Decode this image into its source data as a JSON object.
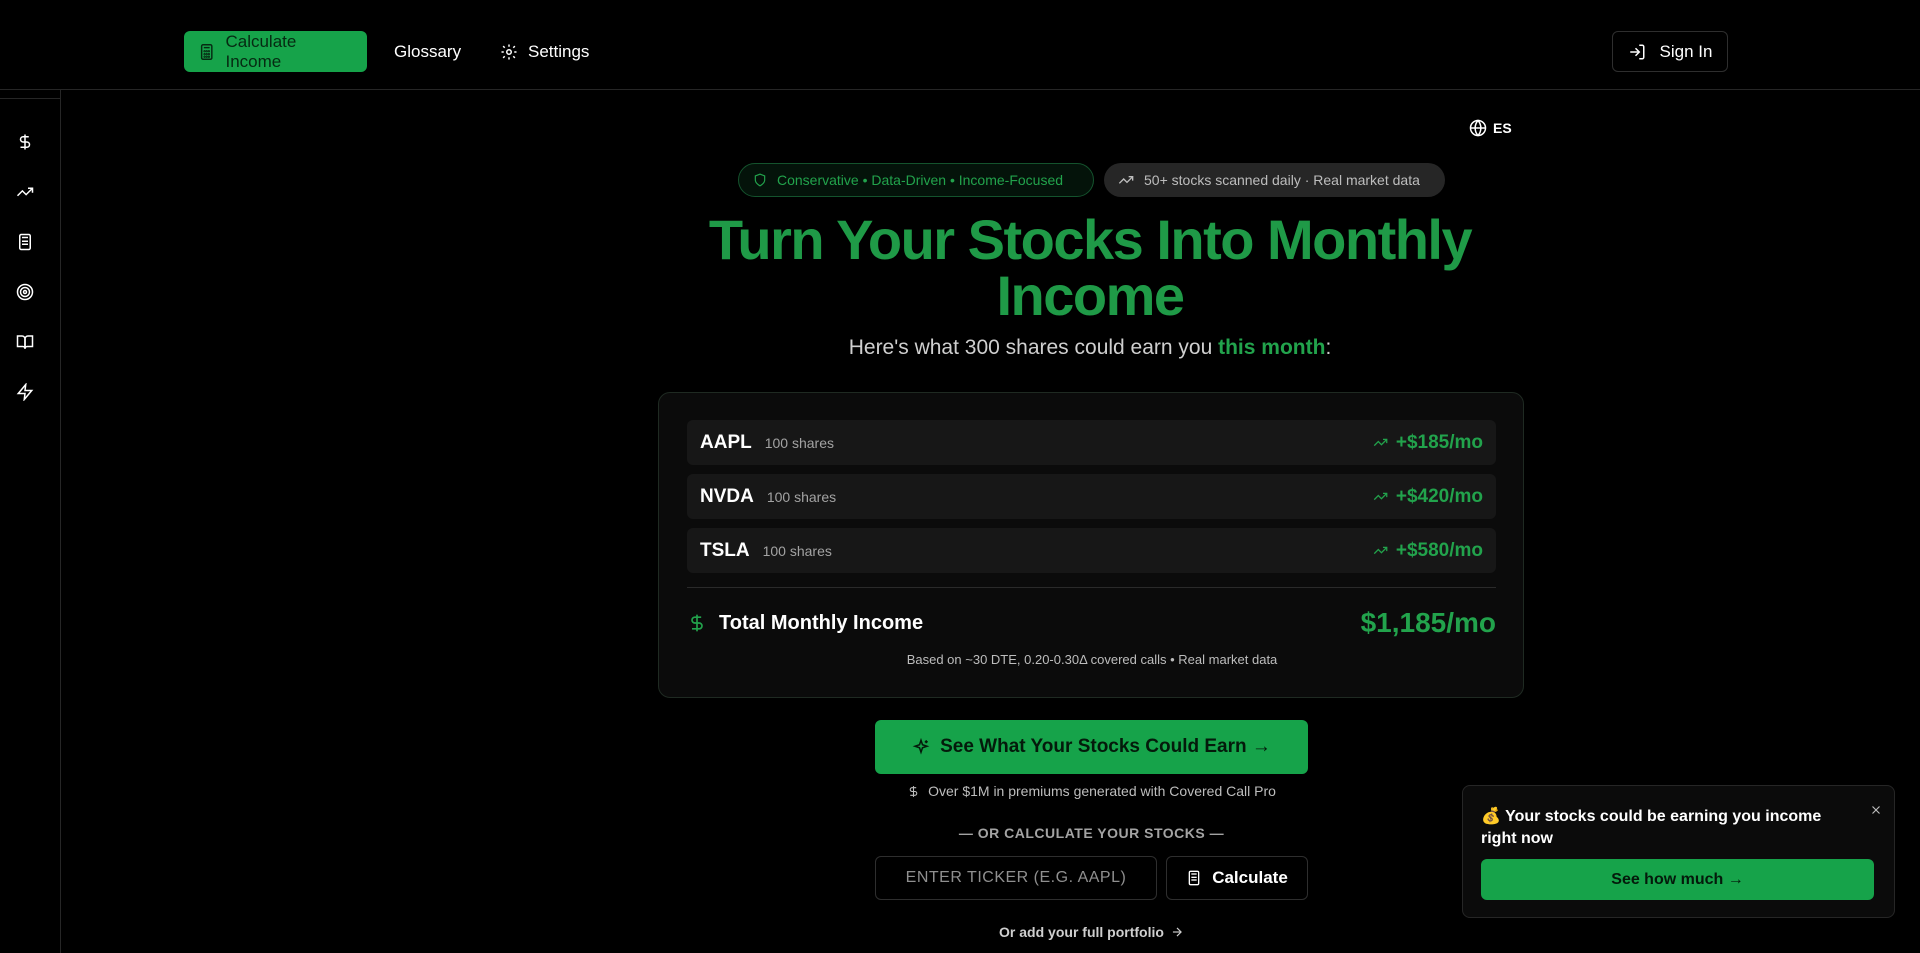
{
  "nav": {
    "calculate_label": "Calculate Income",
    "glossary_label": "Glossary",
    "settings_label": "Settings",
    "signin_label": "Sign In"
  },
  "lang": "ES",
  "badges": {
    "values": "Conservative • Data-Driven • Income-Focused",
    "scan": "50+ stocks scanned daily · Real market data"
  },
  "hero": {
    "title": "Turn Your Stocks Into Monthly Income",
    "sub_before": "Here's what 300 shares could earn you ",
    "sub_highlight": "this month",
    "sub_after": ":"
  },
  "card": {
    "rows": [
      {
        "ticker": "AAPL",
        "shares": "100 shares",
        "amount": "+$185/mo"
      },
      {
        "ticker": "NVDA",
        "shares": "100 shares",
        "amount": "+$420/mo"
      },
      {
        "ticker": "TSLA",
        "shares": "100 shares",
        "amount": "+$580/mo"
      }
    ],
    "total_label": "Total Monthly Income",
    "total_value": "$1,185/mo",
    "note": "Based on ~30 DTE, 0.20-0.30Δ covered calls • Real market data"
  },
  "cta": {
    "label": "See What Your Stocks Could Earn →",
    "proof": "Over $1M in premiums generated with Covered Call Pro"
  },
  "calc": {
    "divider": "— OR CALCULATE YOUR STOCKS —",
    "placeholder": "ENTER TICKER (E.G. AAPL)",
    "button": "Calculate",
    "portfolio_link": "Or add your full portfolio"
  },
  "toast": {
    "message": "💰 Your stocks could be earning you income right now",
    "button": "See how much →"
  },
  "colors": {
    "accent": "#16a34a",
    "accent_text": "#22a34c",
    "background": "#000000"
  }
}
